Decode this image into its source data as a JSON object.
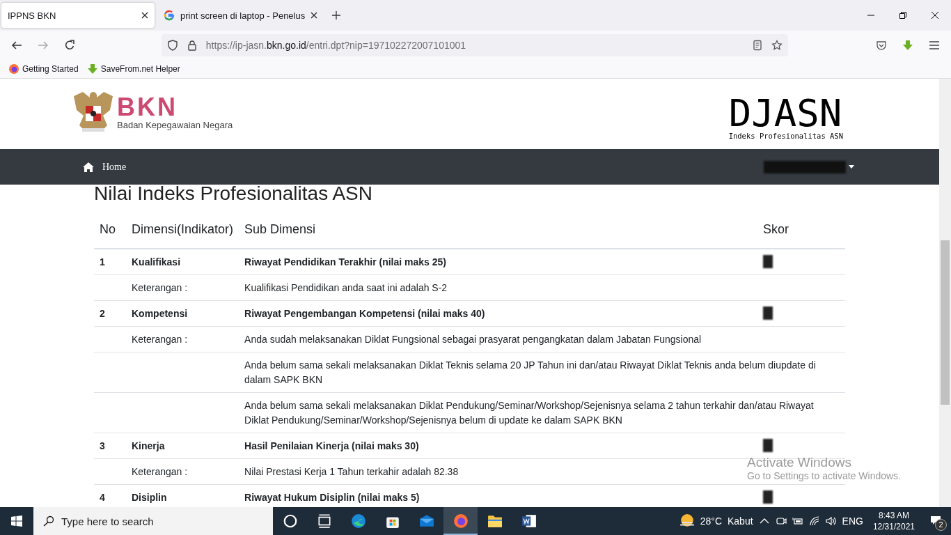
{
  "browser": {
    "tabs": [
      {
        "title": "IPPNS BKN",
        "selected": true,
        "kind": "plain"
      },
      {
        "title": "print screen di laptop - Penelus",
        "selected": false,
        "kind": "google"
      }
    ],
    "url": {
      "start": "https://ip-jasn.",
      "domain": "bkn.go.id",
      "rest": "/entri.dpt?nip=197102272007101001"
    },
    "bookmarks": [
      {
        "label": "Getting Started",
        "kind": "firefox"
      },
      {
        "label": "SaveFrom.net Helper",
        "kind": "download"
      }
    ]
  },
  "site": {
    "logo_word": "BKN",
    "logo_sub": "Badan Kepegawaian Negara",
    "brand": "DJASN",
    "brand_sub": "Indeks Profesionalitas ASN",
    "nav_home": "Home"
  },
  "page_title": "Nilai Indeks Profesionalitas ASN",
  "table": {
    "columns": [
      "No",
      "Dimensi(Indikator)",
      "Sub Dimensi",
      "Skor"
    ],
    "rows": [
      {
        "kind": "dimension",
        "no": "1",
        "name": "Kualifikasi",
        "sub": "Riwayat Pendidikan Terakhir (nilai maks 25)"
      },
      {
        "kind": "note",
        "label": "Keterangan :",
        "text": "Kualifikasi Pendidikan anda saat ini adalah S-2"
      },
      {
        "kind": "dimension",
        "no": "2",
        "name": "Kompetensi",
        "sub": "Riwayat Pengembangan Kompetensi (nilai maks 40)"
      },
      {
        "kind": "note",
        "label": "Keterangan :",
        "text": "Anda sudah melaksanakan Diklat Fungsional sebagai prasyarat pengangkatan dalam Jabatan Fungsional"
      },
      {
        "kind": "note",
        "text": "Anda belum sama sekali melaksanakan Diklat Teknis selama 20 JP Tahun ini dan/atau Riwayat Diklat Teknis anda belum diupdate di dalam SAPK BKN"
      },
      {
        "kind": "note",
        "text": "Anda belum sama sekali melaksanakan Diklat Pendukung/Seminar/Workshop/Sejenisnya selama 2 tahun terkahir dan/atau Riwayat Diklat Pendukung/Seminar/Workshop/Sejenisnya belum di update ke dalam SAPK BKN"
      },
      {
        "kind": "dimension",
        "no": "3",
        "name": "Kinerja",
        "sub": "Hasil Penilaian Kinerja (nilai maks 30)"
      },
      {
        "kind": "note",
        "label": "Keterangan :",
        "text": "Nilai Prestasi Kerja 1 Tahun terkahir adalah 82.38"
      },
      {
        "kind": "dimension",
        "no": "4",
        "name": "Disiplin",
        "sub": "Riwayat Hukum Disiplin (nilai maks 5)"
      }
    ]
  },
  "activation": {
    "title": "Activate Windows",
    "hint": "Go to Settings to activate Windows."
  },
  "taskbar": {
    "search_placeholder": "Type here to search",
    "apps": [
      {
        "kind": "cortana",
        "selected": false
      },
      {
        "kind": "taskview",
        "selected": false
      },
      {
        "kind": "edge",
        "selected": false
      },
      {
        "kind": "store",
        "selected": false
      },
      {
        "kind": "mail",
        "selected": false
      },
      {
        "kind": "firefox",
        "selected": true
      },
      {
        "kind": "folder",
        "selected": false
      },
      {
        "kind": "word",
        "selected": false
      }
    ],
    "temperature": "28°C",
    "weather": "Kabut",
    "language": "ENG",
    "time": "8:43 AM",
    "date": "12/31/2021",
    "notifications": "2"
  }
}
